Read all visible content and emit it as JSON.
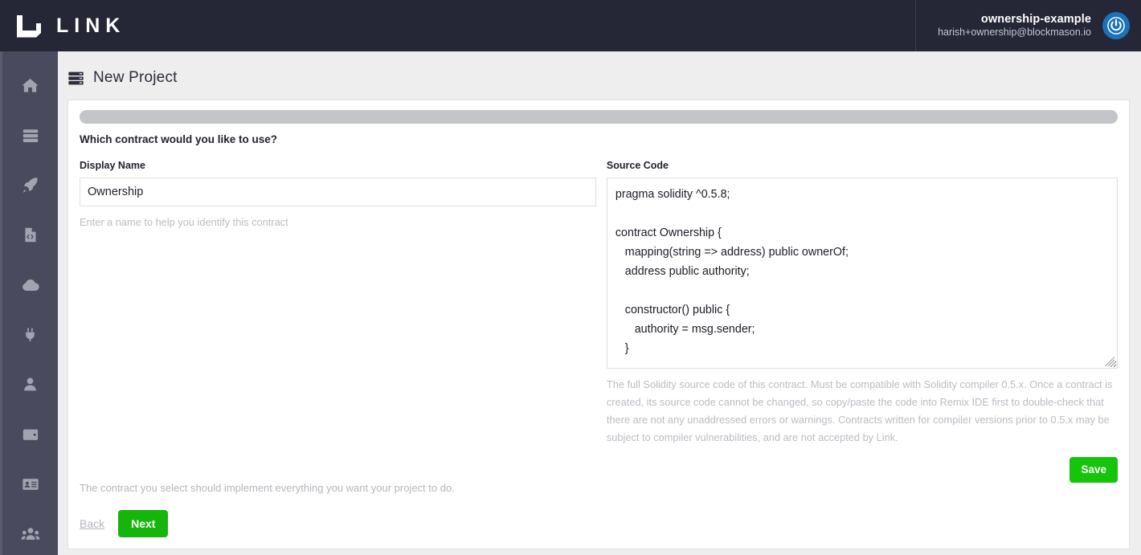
{
  "topbar": {
    "brand_name": "LINK",
    "brand_icon": "link-logo-icon",
    "account_name": "ownership-example",
    "account_email": "harish+ownership@blockmason.io",
    "power_icon": "power-icon",
    "accent_blue": "#1a72ba",
    "background": "#252636"
  },
  "sidebar": {
    "background": "#4a4a5f",
    "items": [
      {
        "icon": "home-icon",
        "name": "sidebar-item-home"
      },
      {
        "icon": "server-icon",
        "name": "sidebar-item-projects"
      },
      {
        "icon": "rocket-icon",
        "name": "sidebar-item-deploy"
      },
      {
        "icon": "file-code-icon",
        "name": "sidebar-item-contracts"
      },
      {
        "icon": "cloud-icon",
        "name": "sidebar-item-cloud"
      },
      {
        "icon": "plug-icon",
        "name": "sidebar-item-integrations"
      },
      {
        "icon": "user-icon",
        "name": "sidebar-item-account"
      },
      {
        "icon": "wallet-icon",
        "name": "sidebar-item-wallet"
      },
      {
        "icon": "id-card-icon",
        "name": "sidebar-item-identity"
      },
      {
        "icon": "users-icon",
        "name": "sidebar-item-team"
      }
    ]
  },
  "page": {
    "title": "New Project",
    "title_icon": "server-icon",
    "progress_percent": 100,
    "progress_color": "#c4c5ca",
    "question": "Which contract would you like to use?"
  },
  "display_name_field": {
    "label": "Display Name",
    "value": "Ownership",
    "placeholder": "",
    "helper": "Enter a name to help you identify this contract"
  },
  "source_code_field": {
    "label": "Source Code",
    "value": "pragma solidity ^0.5.8;\n\ncontract Ownership {\n   mapping(string => address) public ownerOf;\n   address public authority;\n\n   constructor() public {\n      authority = msg.sender;\n   }",
    "placeholder": "",
    "helper": "The full Solidity source code of this contract. Must be compatible with Solidity compiler 0.5.x. Once a contract is created, its source code cannot be changed, so copy/paste the code into Remix IDE first to double-check that there are not any unaddressed errors or warnings. Contracts written for compiler versions prior to 0.5.x may be subject to compiler vulnerabilities, and are not accepted by Link."
  },
  "actions": {
    "save_label": "Save",
    "save_color": "#16c40c",
    "footer_note": "The contract you select should implement everything you want your project to do.",
    "back_label": "Back",
    "next_label": "Next",
    "next_color": "#16b50c"
  }
}
